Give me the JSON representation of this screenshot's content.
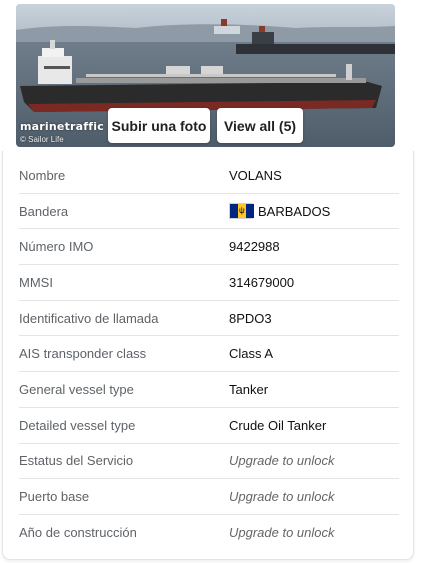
{
  "photo": {
    "watermark": "marinetraffic",
    "credit": "© Sailor Life",
    "upload_label": "Subir una foto",
    "view_all_label": "View all (5)"
  },
  "flag_colors": {
    "blue": "#00267f",
    "gold": "#ffc726"
  },
  "details": [
    {
      "label": "Nombre",
      "value": "VOLANS",
      "locked": false
    },
    {
      "label": "Bandera",
      "value": "BARBADOS",
      "locked": false,
      "flag_icon": "barbados-flag-icon"
    },
    {
      "label": "Número IMO",
      "value": "9422988",
      "locked": false
    },
    {
      "label": "MMSI",
      "value": "314679000",
      "locked": false
    },
    {
      "label": "Identificativo de llamada",
      "value": "8PDO3",
      "locked": false
    },
    {
      "label": "AIS transponder class",
      "value": "Class A",
      "locked": false
    },
    {
      "label": "General vessel type",
      "value": "Tanker",
      "locked": false
    },
    {
      "label": "Detailed vessel type",
      "value": "Crude Oil Tanker",
      "locked": false
    },
    {
      "label": "Estatus del Servicio",
      "value": "Upgrade to unlock",
      "locked": true
    },
    {
      "label": "Puerto base",
      "value": "Upgrade to unlock",
      "locked": true
    },
    {
      "label": "Año de construcción",
      "value": "Upgrade to unlock",
      "locked": true
    }
  ]
}
